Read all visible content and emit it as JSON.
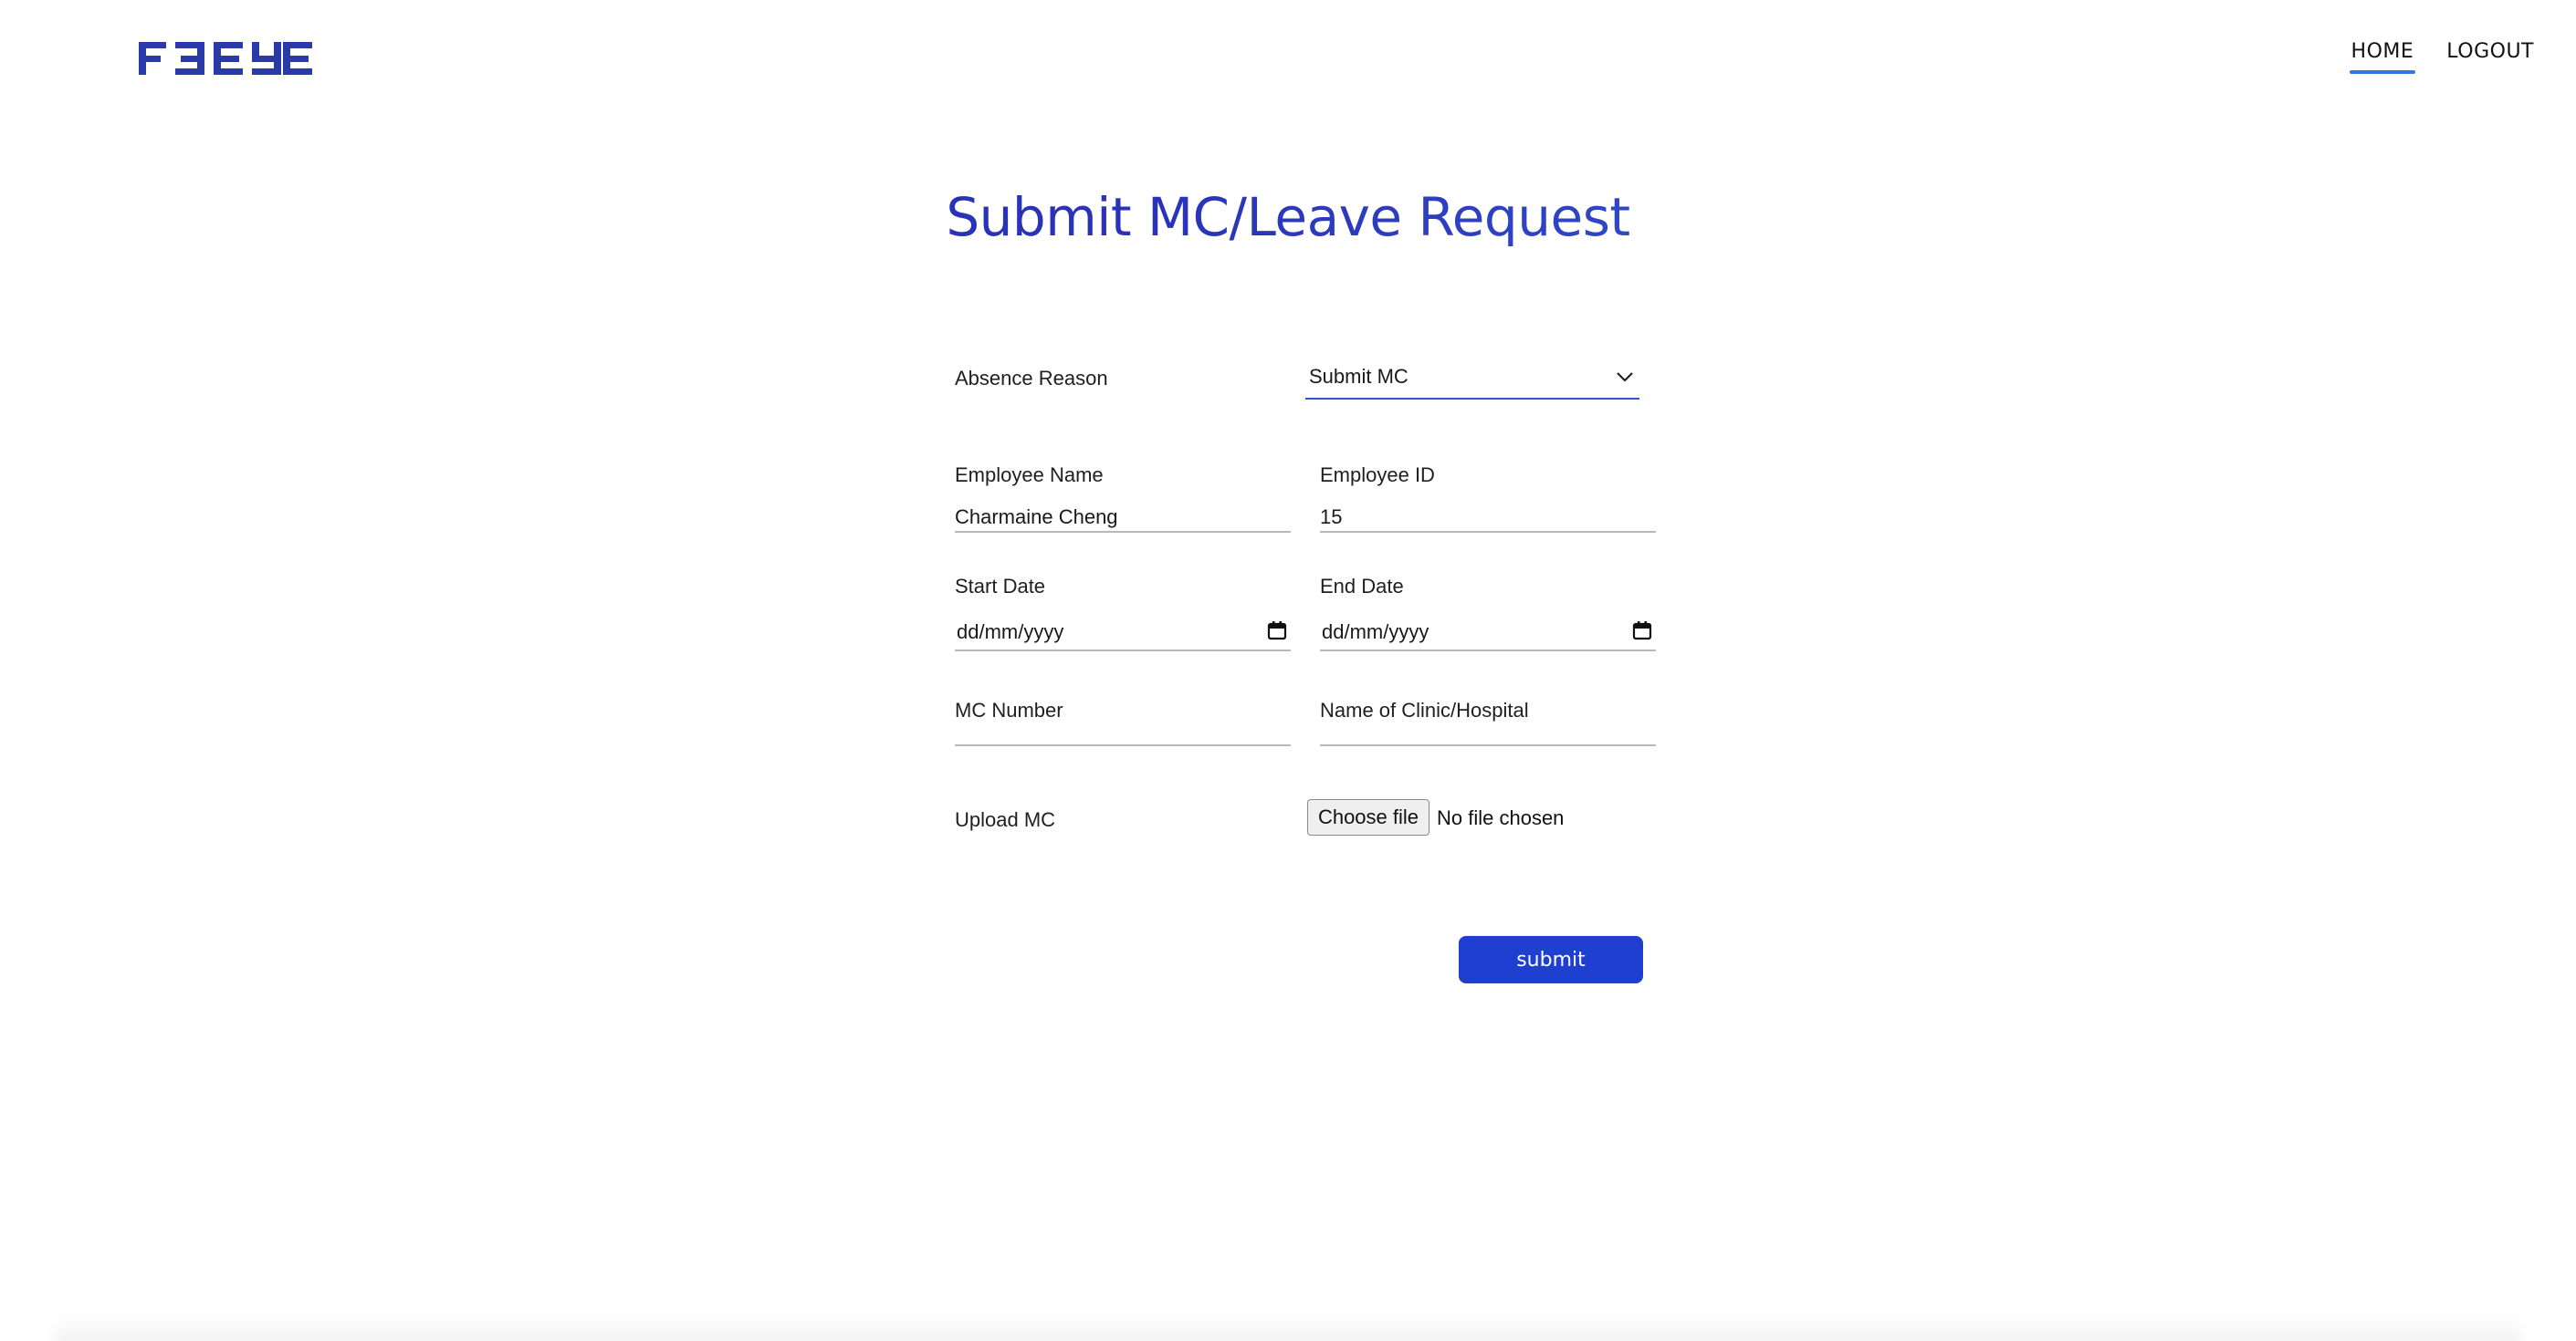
{
  "header": {
    "logo_text": "FBEYE",
    "nav": [
      {
        "label": "HOME",
        "active": true
      },
      {
        "label": "LOGOUT",
        "active": false
      }
    ]
  },
  "title": "Submit MC/Leave Request",
  "form": {
    "absence_reason": {
      "label": "Absence Reason",
      "value": "Submit MC"
    },
    "employee_name": {
      "label": "Employee Name",
      "value": "Charmaine Cheng"
    },
    "employee_id": {
      "label": "Employee ID",
      "value": "15"
    },
    "start_date": {
      "label": "Start Date",
      "placeholder": "dd/mm/yyyy"
    },
    "end_date": {
      "label": "End Date",
      "placeholder": "dd/mm/yyyy"
    },
    "mc_number": {
      "label": "MC Number",
      "value": ""
    },
    "clinic_name": {
      "label": "Name of Clinic/Hospital",
      "value": ""
    },
    "upload_mc": {
      "label": "Upload MC",
      "button": "Choose file",
      "status": "No file chosen"
    },
    "submit_label": "submit"
  },
  "colors": {
    "brand": "#2a3aa8",
    "primary_button": "#1e3fcf",
    "nav_underline": "#2f7ad9",
    "select_underline": "#2f55d4"
  },
  "icons": [
    "fbeye-logo",
    "chevron-down-icon",
    "calendar-icon"
  ]
}
